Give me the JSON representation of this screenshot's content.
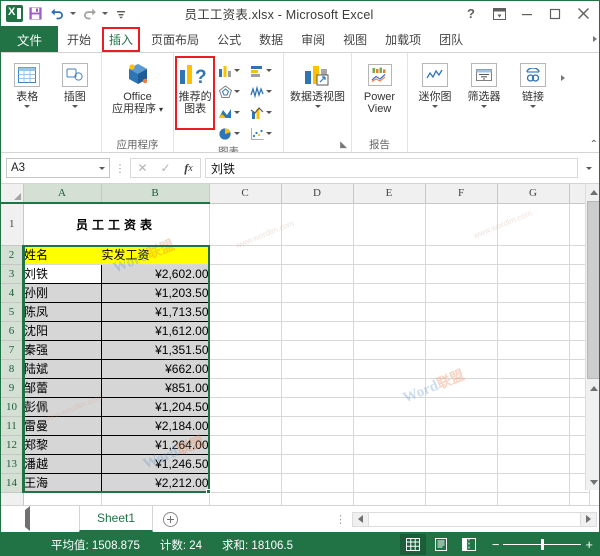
{
  "window": {
    "title": "员工工资表.xlsx - Microsoft Excel",
    "app_icon": "excel-logo-icon",
    "help_label": "?",
    "ribbon_options_label": "ribbon-display-icon",
    "minimize_label": "—",
    "maximize_label": "☐",
    "close_label": "✕"
  },
  "quick_access": {
    "save": "save-icon",
    "undo": "undo-icon",
    "redo": "redo-icon",
    "customize": "customize-qat-icon"
  },
  "tabs": [
    {
      "label": "文件",
      "active": false
    },
    {
      "label": "开始",
      "active": false
    },
    {
      "label": "插入",
      "active": true
    },
    {
      "label": "页面布局",
      "active": false
    },
    {
      "label": "公式",
      "active": false
    },
    {
      "label": "数据",
      "active": false
    },
    {
      "label": "审阅",
      "active": false
    },
    {
      "label": "视图",
      "active": false
    },
    {
      "label": "加载项",
      "active": false
    },
    {
      "label": "团队",
      "active": false
    }
  ],
  "ribbon": {
    "groups": [
      {
        "label": "",
        "buttons": [
          {
            "label": "表格",
            "icon": "table-icon",
            "has_dropdown": true
          },
          {
            "label": "插图",
            "icon": "illustration-icon",
            "has_dropdown": true
          }
        ]
      },
      {
        "label": "应用程序",
        "buttons": [
          {
            "label": "Office\n应用程序",
            "icon": "office-apps-icon",
            "has_dropdown": true
          }
        ]
      },
      {
        "label": "图表",
        "highlighted_button": "推荐的图表",
        "buttons": [
          {
            "label": "推荐的\n图表",
            "icon": "recommended-charts-icon",
            "has_dropdown": false
          }
        ],
        "chart_types": [
          "column-chart-icon",
          "bar-chart-icon",
          "radar-chart-icon",
          "line-chart-icon",
          "area-chart-icon",
          "combo-chart-icon",
          "pie-chart-icon",
          "scatter-chart-icon"
        ]
      },
      {
        "label": "",
        "buttons": [
          {
            "label": "数据透视图",
            "icon": "pivot-chart-icon",
            "has_dropdown": true
          }
        ]
      },
      {
        "label": "报告",
        "buttons": [
          {
            "label": "Power\nView",
            "icon": "power-view-icon",
            "has_dropdown": false
          }
        ]
      },
      {
        "label": "",
        "buttons": [
          {
            "label": "迷你图",
            "icon": "sparkline-icon",
            "has_dropdown": true
          },
          {
            "label": "筛选器",
            "icon": "slicer-icon",
            "has_dropdown": true
          },
          {
            "label": "链接",
            "icon": "hyperlink-icon",
            "has_dropdown": true
          }
        ]
      }
    ]
  },
  "formula_bar": {
    "name_box": "A3",
    "cancel_icon": "cancel-icon",
    "confirm_icon": "confirm-icon",
    "fx_icon": "fx-icon",
    "value": "刘铁",
    "expand_icon": "expand-formula-bar-icon"
  },
  "sheet": {
    "columns": [
      "A",
      "B",
      "C",
      "D",
      "E",
      "F",
      "G"
    ],
    "rows": [
      "1",
      "2",
      "3",
      "4",
      "5",
      "6",
      "7",
      "8",
      "9",
      "10",
      "11",
      "12",
      "13",
      "14"
    ],
    "title_cell": "员工工资表",
    "headers": [
      "姓名",
      "实发工资"
    ],
    "data": [
      {
        "row": "3",
        "name": "刘铁",
        "salary": "¥2,602.00"
      },
      {
        "row": "4",
        "name": "孙刚",
        "salary": "¥1,203.50"
      },
      {
        "row": "5",
        "name": "陈凤",
        "salary": "¥1,713.50"
      },
      {
        "row": "6",
        "name": "沈阳",
        "salary": "¥1,612.00"
      },
      {
        "row": "7",
        "name": "秦强",
        "salary": "¥1,351.50"
      },
      {
        "row": "8",
        "name": "陆斌",
        "salary": "¥662.00"
      },
      {
        "row": "9",
        "name": "邹蕾",
        "salary": "¥851.00"
      },
      {
        "row": "10",
        "name": "彭佩",
        "salary": "¥1,204.50"
      },
      {
        "row": "11",
        "name": "雷曼",
        "salary": "¥2,184.00"
      },
      {
        "row": "12",
        "name": "郑黎",
        "salary": "¥1,264.00"
      },
      {
        "row": "13",
        "name": "潘越",
        "salary": "¥1,246.50"
      },
      {
        "row": "14",
        "name": "王海",
        "salary": "¥2,212.00"
      }
    ],
    "active_cell": "A3",
    "selection": "A2:B14",
    "header_fill": "#ffff00",
    "selection_fill": "#d6d6d6"
  },
  "sheet_tabs": {
    "tabs": [
      "Sheet1"
    ],
    "active": "Sheet1",
    "add_label": "add-sheet-icon"
  },
  "status_bar": {
    "average": "平均值: 1508.875",
    "count": "计数: 24",
    "sum": "求和: 18106.5",
    "views": [
      "normal-view-icon",
      "page-layout-view-icon",
      "page-break-view-icon"
    ],
    "active_view": "normal-view-icon",
    "zoom_out": "−",
    "zoom_in": "+"
  },
  "watermarks": {
    "brand_1": "Word",
    "brand_2": "联盟",
    "url": "www.wordlm.com"
  },
  "colors": {
    "accent": "#217346",
    "highlight_box": "#ec1c24",
    "header_yellow": "#ffff00"
  }
}
